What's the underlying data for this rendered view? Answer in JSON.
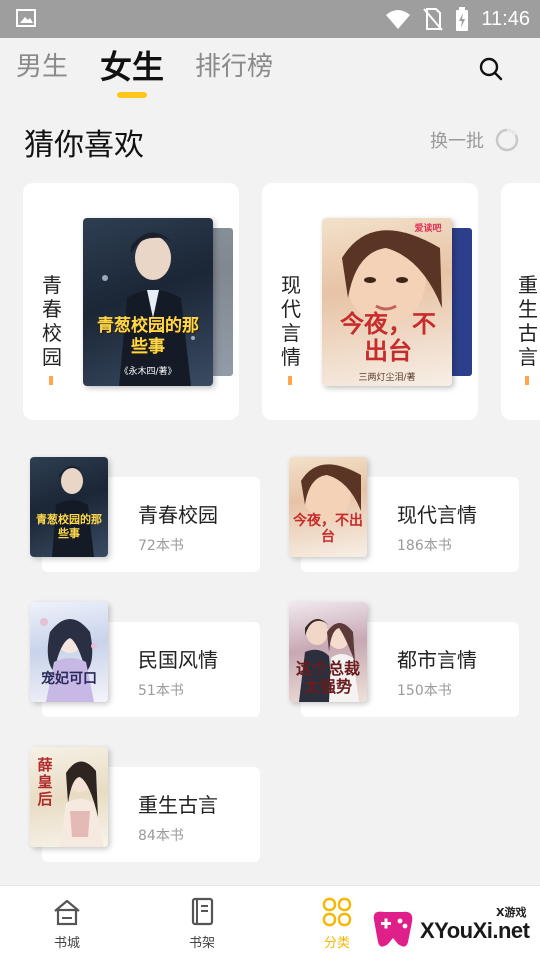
{
  "status_bar": {
    "time": "11:46",
    "icons": [
      "image-icon",
      "wifi-icon",
      "no-sim-icon",
      "battery-charging-icon"
    ]
  },
  "tabs": [
    {
      "label": "男生",
      "active": false
    },
    {
      "label": "女生",
      "active": true
    },
    {
      "label": "排行榜",
      "active": false
    }
  ],
  "guess": {
    "title": "猜你喜欢",
    "refresh_label": "换一批",
    "cards": [
      {
        "label": "青春校园",
        "cover_title": "青葱校园的那些事",
        "cover_author": "《永木四/著》"
      },
      {
        "label": "现代言情",
        "cover_title": "今夜，不出台",
        "cover_author": "三两灯尘泪/著",
        "cover_badge": "爱读吧"
      },
      {
        "label": "重生古言"
      }
    ]
  },
  "categories": [
    {
      "name": "青春校园",
      "count": "72本书",
      "cover_text": "青葱校园的那些事"
    },
    {
      "name": "现代言情",
      "count": "186本书",
      "cover_text": "今夜，不出台"
    },
    {
      "name": "民国风情",
      "count": "51本书",
      "cover_text": "宠妃可口"
    },
    {
      "name": "都市言情",
      "count": "150本书",
      "cover_text": "这个总裁太强势"
    },
    {
      "name": "重生古言",
      "count": "84本书",
      "cover_text": "薛皇后"
    }
  ],
  "bottom_nav": [
    {
      "label": "书城",
      "icon": "store-icon",
      "active": false
    },
    {
      "label": "书架",
      "icon": "bookshelf-icon",
      "active": false
    },
    {
      "label": "分类",
      "icon": "category-icon",
      "active": true
    }
  ],
  "watermark": {
    "text": "XYouXi.net",
    "small": "X游戏"
  },
  "colors": {
    "accent": "#ffc51a",
    "tag_orange": "#ffa54a",
    "background": "#f2f2f2"
  }
}
